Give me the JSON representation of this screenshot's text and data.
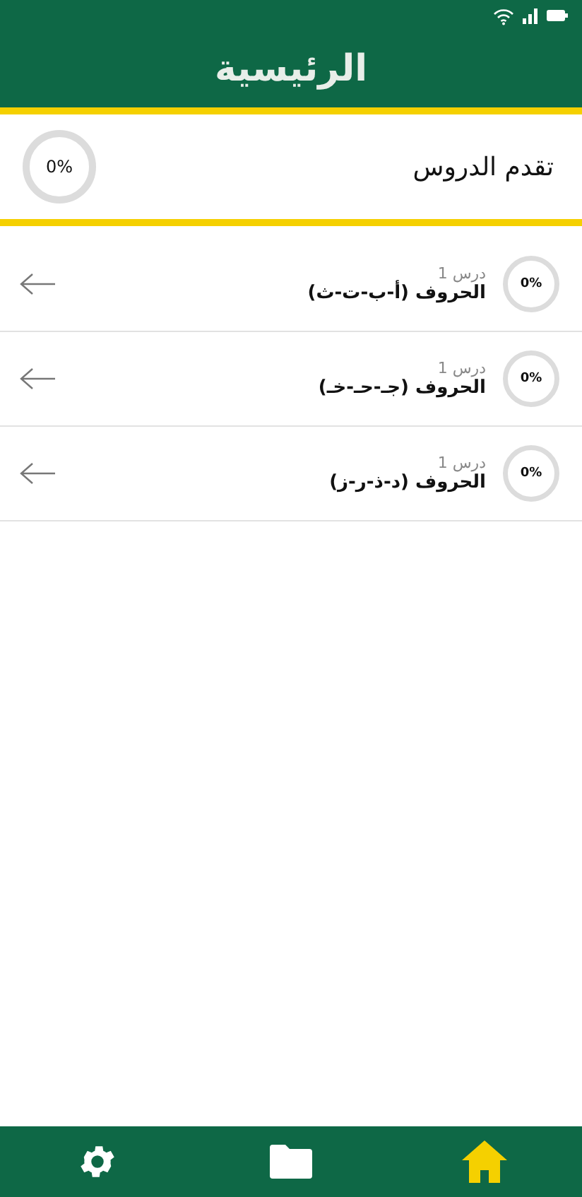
{
  "header": {
    "title": "الرئيسية"
  },
  "overall_progress": {
    "label": "تقدم الدروس",
    "reading": "0%",
    "level": 0
  },
  "lessons": [
    {
      "subtitle": "درس 1",
      "title": "الحروف (أ-ب-ت-ث)",
      "reading": "0%",
      "level": 0
    },
    {
      "subtitle": "درس 1",
      "title": "الحروف (جـ-حـ-خـ)",
      "reading": "0%",
      "level": 0
    },
    {
      "subtitle": "درس 1",
      "title": "الحروف (د-ذ-ر-ز)",
      "reading": "0%",
      "level": 0
    }
  ],
  "bottom_nav": [
    {
      "kind": "settings",
      "selected": false
    },
    {
      "kind": "folder",
      "selected": false
    },
    {
      "kind": "home",
      "selected": true
    }
  ]
}
